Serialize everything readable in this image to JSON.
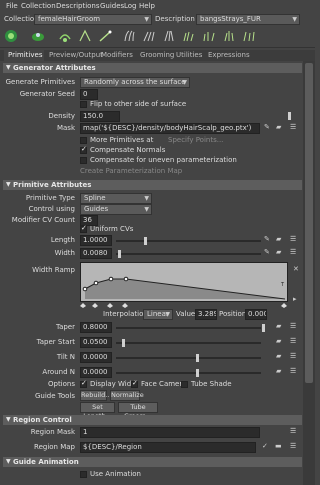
{
  "menu": [
    "File",
    "Collection",
    "Descriptions",
    "Guides",
    "Log",
    "Help"
  ],
  "collection": {
    "label": "Collection",
    "value": "femaleHairGroom",
    "desc_label": "Description",
    "desc_value": "bangsStrays_FUR"
  },
  "tabs": [
    "Primitives",
    "Preview/Output",
    "Modifiers",
    "Grooming",
    "Utilities",
    "Expressions"
  ],
  "generator": {
    "title": "Generator Attributes",
    "gen_prim_label": "Generate Primitives",
    "gen_prim_value": "Randomly across the surface",
    "seed_label": "Generator Seed",
    "seed_value": "0",
    "flip_label": "Flip to other side of surface",
    "density_label": "Density",
    "density_value": "150.0",
    "mask_label": "Mask",
    "mask_value": "map('${DESC}/density/bodyHairScalp_geo.ptx')",
    "more_prims_label": "More Primitives at",
    "specify_points": "Specify Points...",
    "comp_normals": "Compensate Normals",
    "comp_uneven": "Compensate for uneven parameterization",
    "create_param_map": "Create Parameterization Map"
  },
  "primitive": {
    "title": "Primitive Attributes",
    "type_label": "Primitive Type",
    "type_value": "Spline",
    "control_label": "Control using",
    "control_value": "Guides",
    "cv_label": "Modifier CV Count",
    "cv_value": "36",
    "uniform_cvs": "Uniform CVs",
    "length_label": "Length",
    "length_value": "1.0000",
    "width_label": "Width",
    "width_value": "0.0080",
    "ramp_label": "Width Ramp",
    "interp_label": "Interpolation",
    "interp_value": "Linear",
    "value_label": "Value",
    "value_value": "3.289",
    "position_label": "Position",
    "position_value": "0.000",
    "taper_label": "Taper",
    "taper_value": "0.8000",
    "taper_start_label": "Taper Start",
    "taper_start_value": "0.0500",
    "tilt_label": "Tilt N",
    "tilt_value": "0.0000",
    "around_label": "Around N",
    "around_value": "0.0000",
    "options_label": "Options",
    "display_width": "Display Width",
    "face_camera": "Face Camera",
    "tube_shade": "Tube Shade",
    "guide_tools_label": "Guide Tools",
    "rebuild": "Rebuild...",
    "normalize": "Normalize",
    "set_length": "Set Length...",
    "tube_groom": "Tube Groom..."
  },
  "region": {
    "title": "Region Control",
    "mask_label": "Region Mask",
    "mask_value": "1",
    "map_label": "Region Map",
    "map_value": "${DESC}/Region"
  },
  "guide_anim": {
    "title": "Guide Animation",
    "use_anim": "Use Animation"
  }
}
